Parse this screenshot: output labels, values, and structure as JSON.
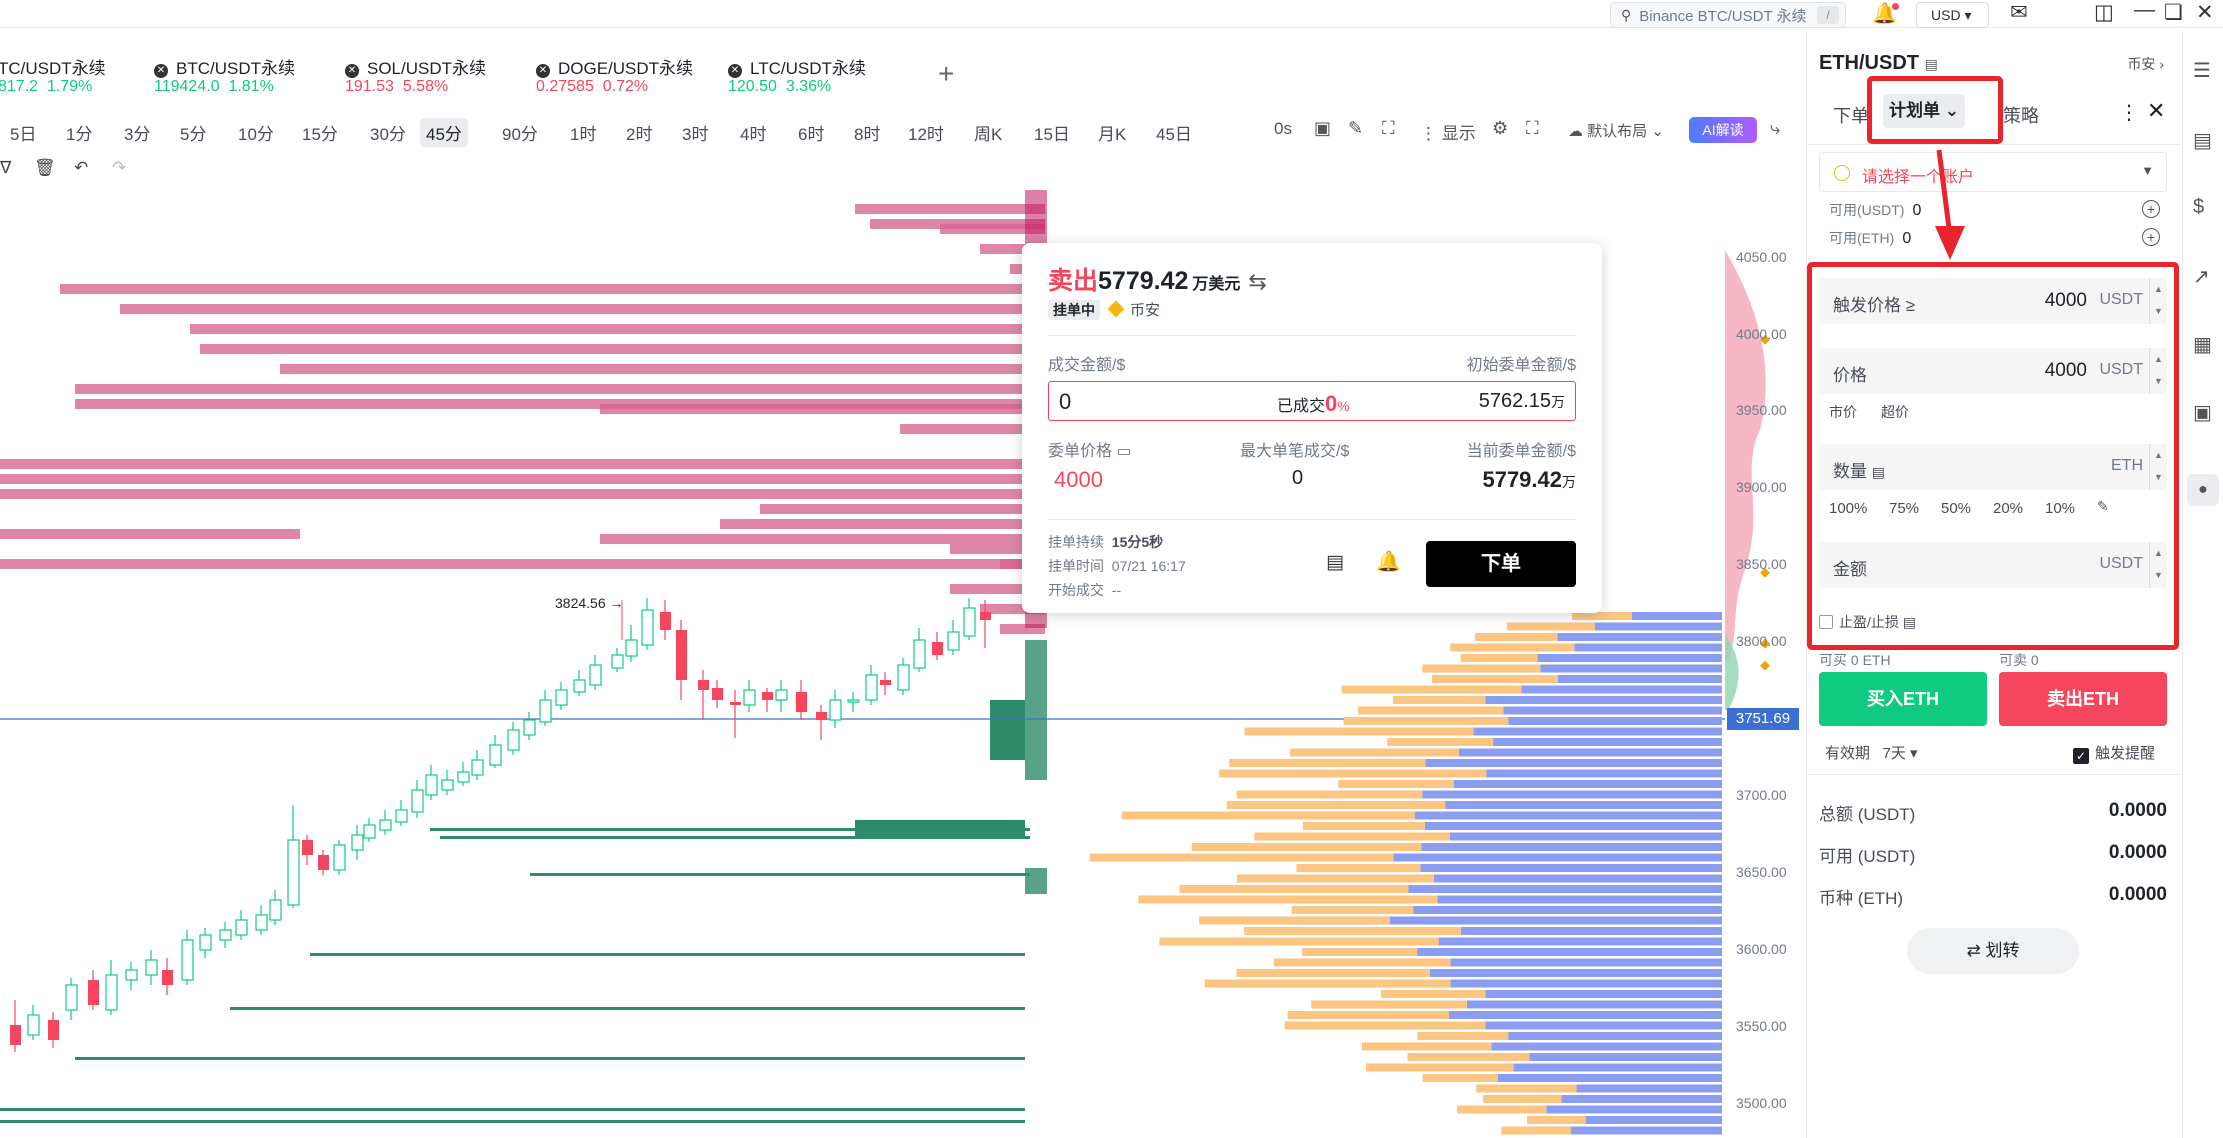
{
  "system": {
    "search_placeholder": "Binance BTC/USDT 永续",
    "search_shortcut": "/",
    "currency": "USD",
    "icons": [
      "search-icon",
      "bell-icon",
      "mail-icon",
      "layout-icon",
      "minimize-icon",
      "restore-icon",
      "close-icon"
    ]
  },
  "tickers": [
    {
      "name": "TC/USDT永续",
      "price": "817.2",
      "change": "1.79%",
      "dir": "up"
    },
    {
      "name": "BTC/USDT永续",
      "price": "119424.0",
      "change": "1.81%",
      "dir": "up"
    },
    {
      "name": "SOL/USDT永续",
      "price": "191.53",
      "change": "5.58%",
      "dir": "dn"
    },
    {
      "name": "DOGE/USDT永续",
      "price": "0.27585",
      "change": "0.72%",
      "dir": "dn"
    },
    {
      "name": "LTC/USDT永续",
      "price": "120.50",
      "change": "3.36%",
      "dir": "up"
    }
  ],
  "add_tab": "+",
  "timeframes": [
    "5日",
    "1分",
    "3分",
    "5分",
    "10分",
    "15分",
    "30分",
    "45分",
    "90分",
    "1时",
    "2时",
    "3时",
    "4时",
    "6时",
    "8时",
    "12时",
    "周K",
    "15日",
    "月K",
    "45日"
  ],
  "active_timeframe": "45分",
  "toolbar": {
    "countdown": "0s",
    "display": "显示",
    "layout": "默认布局",
    "ai": "AI解读"
  },
  "chart": {
    "high_label": "3824.56",
    "current_price": "3751.69",
    "axis_ticks": [
      "4050.00",
      "4000.00",
      "3950.00",
      "3900.00",
      "3850.00",
      "3800.00",
      "3700.00",
      "3650.00",
      "3600.00",
      "3550.00",
      "3500.00"
    ],
    "colors": {
      "up": "#0ecb81",
      "down": "#f6465d",
      "ask_heat": "#d6648f",
      "bid_heat": "#2e8b6a",
      "vol_orange": "#fdc582",
      "vol_blue": "#8a9df0"
    }
  },
  "chart_data": {
    "type": "table",
    "symbol": "ETH/USDT",
    "high_marker": 3824.56,
    "last_price": 3751.69,
    "y_ticks": [
      4050,
      4000,
      3950,
      3900,
      3850,
      3800,
      3700,
      3650,
      3600,
      3550,
      3500
    ]
  },
  "popup": {
    "side": "卖出",
    "amount": "5779.42",
    "unit": "万美元",
    "status": "挂单中",
    "exchange": "币安",
    "label_filled_amount": "成交金额/$",
    "label_initial_amount": "初始委单金额/$",
    "filled_value": "0",
    "filled_pct_label": "已成交",
    "filled_pct": "0",
    "pct_sign": "%",
    "initial_value": "5762.15",
    "wan": "万",
    "label_order_price": "委单价格",
    "label_max_fill": "最大单笔成交/$",
    "label_current_amount": "当前委单金额/$",
    "order_price": "4000",
    "max_fill": "0",
    "current_amount": "5779.42",
    "duration_label": "挂单持续",
    "duration": "15分5秒",
    "time_label": "挂单时间",
    "time": "07/21 16:17",
    "start_label": "开始成交",
    "start": "--",
    "order_button": "下单"
  },
  "panel": {
    "symbol": "ETH/USDT",
    "exchange": "币安",
    "tabs": [
      "下单",
      "计划单",
      "策略"
    ],
    "account_placeholder": "请选择一个账户",
    "avail_usdt_label": "可用(USDT)",
    "avail_usdt": "0",
    "avail_eth_label": "可用(ETH)",
    "avail_eth": "0",
    "trigger_label": "触发价格 ≥",
    "trigger_value": "4000",
    "trigger_unit": "USDT",
    "price_label": "价格",
    "price_value": "4000",
    "price_unit": "USDT",
    "market": "市价",
    "over_price": "超价",
    "qty_label": "数量",
    "qty_unit": "ETH",
    "pcts": [
      "100%",
      "75%",
      "50%",
      "20%",
      "10%"
    ],
    "amount_label": "金额",
    "amount_unit": "USDT",
    "tpsl": "止盈/止损",
    "can_buy_label": "可买",
    "can_buy": "0 ETH",
    "can_sell_label": "可卖",
    "can_sell": "0",
    "buy_button": "买入ETH",
    "sell_button": "卖出ETH",
    "validity_label": "有效期",
    "validity": "7天",
    "trigger_alert": "触发提醒",
    "total_label": "总额 (USDT)",
    "total": "0.0000",
    "available_label": "可用 (USDT)",
    "available": "0.0000",
    "coin_label": "币种 (ETH)",
    "coin": "0.0000",
    "transfer": "划转"
  }
}
